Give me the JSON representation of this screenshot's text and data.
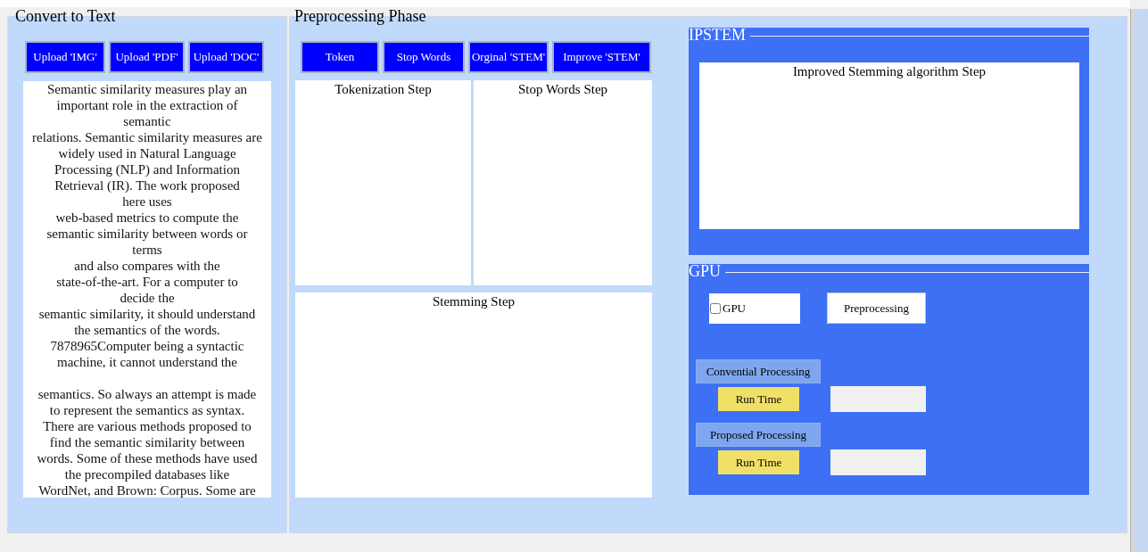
{
  "convert_panel": {
    "title": "Convert to Text",
    "buttons": [
      "Upload 'IMG'",
      "Upload 'PDF'",
      "Upload 'DOC'"
    ],
    "text_paragraphs": [
      [
        "Semantic similarity measures play an",
        "important role in the extraction of",
        "semantic",
        "relations. Semantic similarity measures are",
        "widely used in Natural Language",
        "Processing (NLP) and Information",
        "Retrieval (IR). The work proposed",
        "here uses",
        "web-based metrics to compute the",
        "semantic similarity between words or",
        "terms",
        "and also compares with the",
        "state-of-the-art. For a computer to",
        "decide the",
        "semantic similarity, it should understand",
        "the semantics of the words.",
        "7878965Computer being a syntactic",
        "machine, it cannot understand the"
      ],
      [
        "semantics. So always an attempt is made",
        "to represent the semantics as syntax.",
        "There are various methods proposed to",
        "find the semantic similarity between",
        "words. Some of these methods have used",
        "the precompiled databases like",
        "WordNet, and Brown: Corpus. Some are"
      ]
    ]
  },
  "preprocessing": {
    "title": "Preprocessing Phase",
    "buttons": [
      "Token",
      "Stop Words",
      "Orginal 'STEM'",
      "Improve 'STEM'"
    ],
    "steps": [
      {
        "title": "Tokenization Step"
      },
      {
        "title": "Stop Words Step"
      },
      {
        "title": "Stemming Step"
      }
    ]
  },
  "ipstem": {
    "title": "IPSTEM",
    "output_title": "Improved Stemming algorithm Step"
  },
  "gpu": {
    "title": "GPU",
    "checkbox": {
      "label": "GPU",
      "checked": false
    },
    "button": "Preprocessing",
    "rows": [
      {
        "label": "Convential Processing",
        "button": "Run Time"
      },
      {
        "label": "Proposed Processing",
        "button": "Run Time"
      }
    ]
  }
}
